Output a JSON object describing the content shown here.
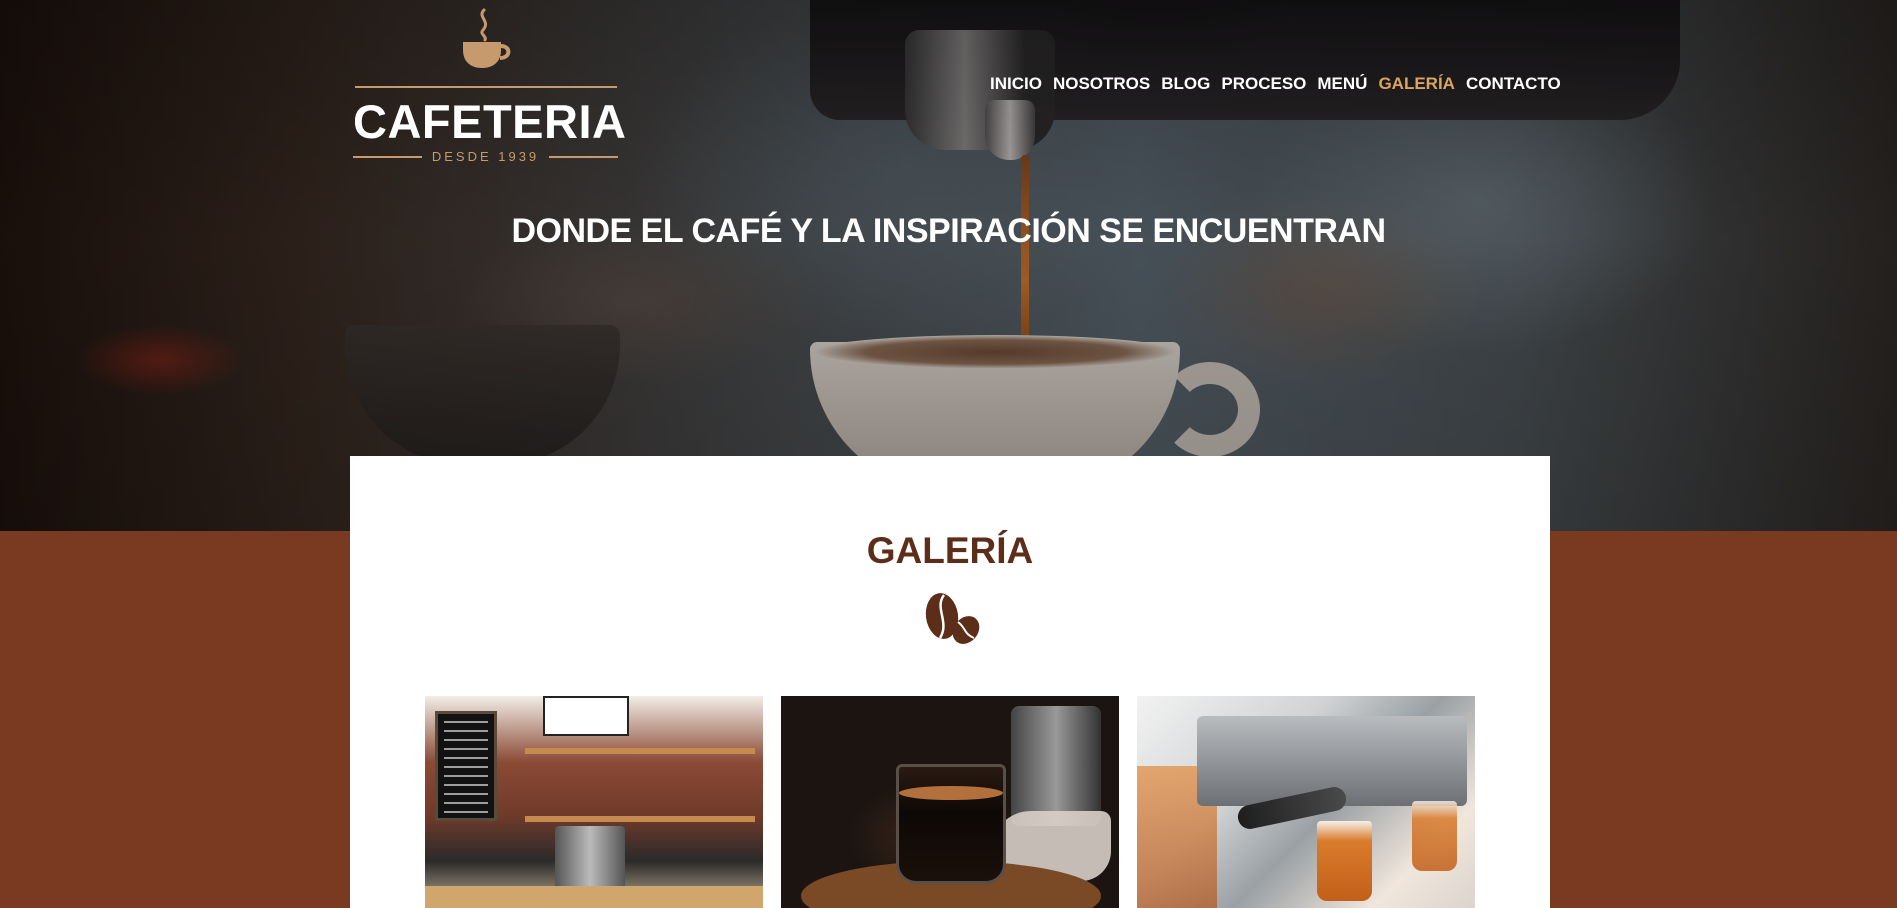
{
  "brand": {
    "name": "CAFETERIA",
    "since": "DESDE 1939"
  },
  "nav": {
    "items": [
      {
        "label": "INICIO"
      },
      {
        "label": "NOSOTROS"
      },
      {
        "label": "BLOG"
      },
      {
        "label": "PROCESO"
      },
      {
        "label": "MENÚ"
      },
      {
        "label": "GALERÍA",
        "active": true
      },
      {
        "label": "CONTACTO"
      }
    ]
  },
  "hero": {
    "tagline": "DONDE EL CAFÉ Y LA INSPIRACIÓN SE ENCUENTRAN"
  },
  "gallery": {
    "title": "GALERÍA",
    "icon": "coffee-beans-icon",
    "images": [
      {
        "name": "gallery-image-coffee-shop-counter"
      },
      {
        "name": "gallery-image-espresso-glass"
      },
      {
        "name": "gallery-image-espresso-machine"
      }
    ]
  },
  "colors": {
    "accent": "#dba560",
    "brand_brown": "#5c2d18",
    "background_brown": "#7a3a22",
    "logo_gold": "#c69a6d"
  }
}
